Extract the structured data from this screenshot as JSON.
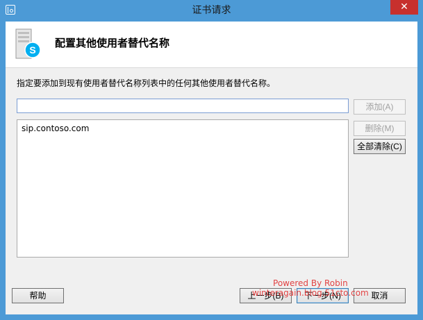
{
  "window": {
    "title": "证书请求",
    "close_glyph": "✕"
  },
  "header": {
    "title": "配置其他使用者替代名称",
    "icon": "skype-server-icon"
  },
  "instruction": "指定要添加到现有使用者替代名称列表中的任何其他使用者替代名称。",
  "input": {
    "value": "",
    "placeholder": ""
  },
  "side_buttons": {
    "add": "添加(A)",
    "delete": "删除(M)",
    "clear_all": "全部清除(C)"
  },
  "names": [
    "sip.contoso.com"
  ],
  "footer": {
    "help": "帮助",
    "back": "上一步(B)",
    "next": "下一步(N)",
    "cancel": "取消"
  },
  "watermark": {
    "line1": "Powered By Robin",
    "line2": "winteragain.blog.51cto.com"
  },
  "colors": {
    "titlebar": "#4c9ad6",
    "close": "#c7302d",
    "skype": "#00aff0"
  }
}
